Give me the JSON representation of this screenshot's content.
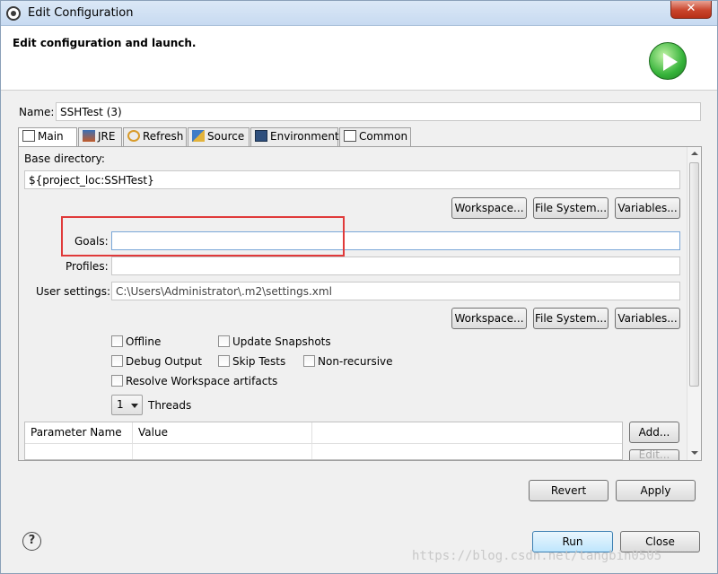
{
  "window": {
    "title": "Edit Configuration",
    "close_label": "✕"
  },
  "header": {
    "title": "Edit configuration and launch."
  },
  "name": {
    "label": "Name:",
    "value": "SSHTest (3)"
  },
  "tabs": [
    {
      "label": "Main",
      "icon": "main-tab-icon",
      "active": true
    },
    {
      "label": "JRE",
      "icon": "jre-tab-icon"
    },
    {
      "label": "Refresh",
      "icon": "refresh-tab-icon"
    },
    {
      "label": "Source",
      "icon": "source-tab-icon"
    },
    {
      "label": "Environment",
      "icon": "environment-tab-icon"
    },
    {
      "label": "Common",
      "icon": "common-tab-icon"
    }
  ],
  "main": {
    "base_dir_label": "Base directory:",
    "base_dir_value": "${project_loc:SSHTest}",
    "buttons1": {
      "workspace": "Workspace...",
      "filesystem": "File System...",
      "variables": "Variables..."
    },
    "goals_label": "Goals:",
    "goals_value": "",
    "profiles_label": "Profiles:",
    "profiles_value": "",
    "user_settings_label": "User settings:",
    "user_settings_value": "C:\\Users\\Administrator\\.m2\\settings.xml",
    "buttons2": {
      "workspace": "Workspace...",
      "filesystem": "File System...",
      "variables": "Variables..."
    },
    "checkboxes": {
      "offline": "Offline",
      "update_snapshots": "Update Snapshots",
      "debug_output": "Debug Output",
      "skip_tests": "Skip Tests",
      "non_recursive": "Non-recursive",
      "resolve_workspace": "Resolve Workspace artifacts"
    },
    "threads_value": "1",
    "threads_label": "Threads",
    "table_headers": [
      "Parameter Name",
      "Value"
    ],
    "add_button": "Add...",
    "edit_button": "Edit..."
  },
  "footer": {
    "revert": "Revert",
    "apply": "Apply",
    "run": "Run",
    "close": "Close",
    "help": "?"
  },
  "watermark": "https://blog.csdn.net/tangbin0505",
  "colors": {
    "highlight": "#e03a3a",
    "focus_border": "#7aa7d8"
  }
}
